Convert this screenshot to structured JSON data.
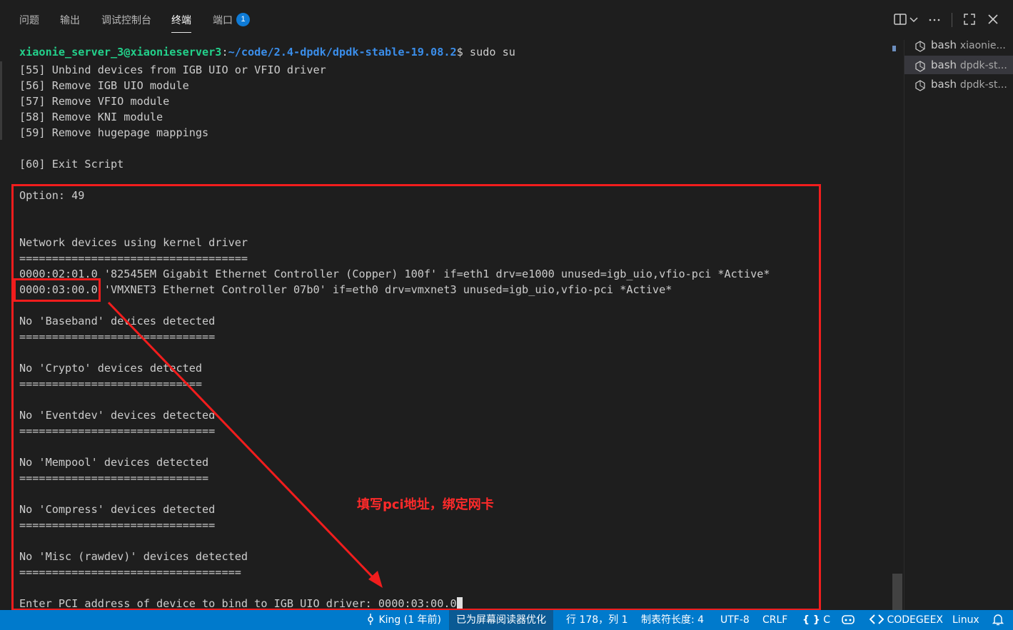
{
  "panel": {
    "tabs": [
      {
        "label": "问题"
      },
      {
        "label": "输出"
      },
      {
        "label": "调试控制台"
      },
      {
        "label": "终端"
      },
      {
        "label": "端口"
      }
    ],
    "active_tab": "终端",
    "ports_badge": "1"
  },
  "terminal": {
    "prompt_user": "xiaonie_server_3@xiaonieserver3",
    "prompt_colon": ":",
    "prompt_path": "~/code/2.4-dpdk/dpdk-stable-19.08.2",
    "prompt_cmd": "$ sudo su",
    "lines": [
      "[55] Unbind devices from IGB UIO or VFIO driver",
      "[56] Remove IGB UIO module",
      "[57] Remove VFIO module",
      "[58] Remove KNI module",
      "[59] Remove hugepage mappings",
      "",
      "[60] Exit Script",
      "",
      "Option: 49",
      "",
      "",
      "Network devices using kernel driver",
      "===================================",
      "0000:02:01.0 '82545EM Gigabit Ethernet Controller (Copper) 100f' if=eth1 drv=e1000 unused=igb_uio,vfio-pci *Active*",
      "0000:03:00.0 'VMXNET3 Ethernet Controller 07b0' if=eth0 drv=vmxnet3 unused=igb_uio,vfio-pci *Active*",
      "",
      "No 'Baseband' devices detected",
      "==============================",
      "",
      "No 'Crypto' devices detected",
      "============================",
      "",
      "No 'Eventdev' devices detected",
      "==============================",
      "",
      "No 'Mempool' devices detected",
      "=============================",
      "",
      "No 'Compress' devices detected",
      "==============================",
      "",
      "No 'Misc (rawdev)' devices detected",
      "==================================",
      "",
      "Enter PCI address of device to bind to IGB UIO driver: 0000:03:00.0"
    ]
  },
  "terminal_list": [
    {
      "name": "bash",
      "detail": "xiaonie..."
    },
    {
      "name": "bash",
      "detail": "dpdk-st..."
    },
    {
      "name": "bash",
      "detail": "dpdk-st..."
    }
  ],
  "annotation": {
    "text": "填写pci地址，绑定网卡",
    "color": "#ff2a2a"
  },
  "statusbar": {
    "git_blame": "King (1 年前)",
    "screen_reader": "已为屏幕阅读器优化",
    "position": "行 178，列 1",
    "tab_size": "制表符长度: 4",
    "encoding": "UTF-8",
    "eol": "CRLF",
    "language": "C",
    "codegeex": "CODEGEEX",
    "os": "Linux"
  },
  "colors": {
    "background": "#1e1e1e",
    "statusbar": "#007acc",
    "prompt_user": "#23d18b",
    "prompt_path": "#3b8eea",
    "annotation_red": "#f11d1d"
  }
}
